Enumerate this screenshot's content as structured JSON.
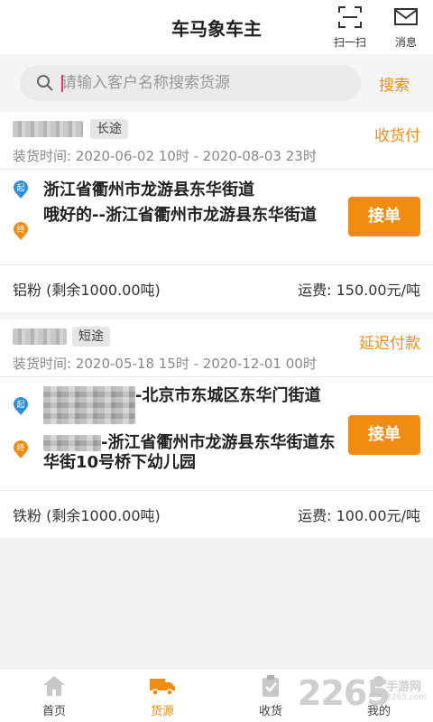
{
  "header": {
    "title": "车马象车主",
    "scan_label": "扫一扫",
    "message_label": "消息"
  },
  "search": {
    "placeholder": "请输入客户名称搜索货源",
    "button_label": "搜索"
  },
  "orders": [
    {
      "route_type": "长途",
      "payment": "收货付",
      "load_time": "装货时间: 2020-06-02 10时 - 2020-08-03 23时",
      "start_icon_label": "起",
      "end_icon_label": "终",
      "start_address": "浙江省衢州市龙游县东华街道",
      "end_address": "哦好的--浙江省衢州市龙游县东华街道",
      "accept_label": "接单",
      "goods": "铝粉 (剩余1000.00吨)",
      "freight": "运费: 150.00元/吨"
    },
    {
      "route_type": "短途",
      "payment": "延迟付款",
      "load_time": "装货时间: 2020-05-18 15时 - 2020-12-01 00时",
      "start_icon_label": "起",
      "end_icon_label": "终",
      "start_address": "-北京市东城区东华门街道",
      "end_address": "-浙江省衢州市龙游县东华街道东华街10号桥下幼儿园",
      "accept_label": "接单",
      "goods": "铁粉 (剩余1000.00吨)",
      "freight": "运费: 100.00元/吨"
    }
  ],
  "tabs": [
    {
      "label": "首页",
      "icon": "home-icon"
    },
    {
      "label": "货源",
      "icon": "truck-icon"
    },
    {
      "label": "收货",
      "icon": "clipboard-check-icon"
    },
    {
      "label": "我的",
      "icon": "user-icon"
    }
  ],
  "watermark": {
    "number": "2265",
    "text": "手游网",
    "url": "2265.com"
  },
  "colors": {
    "accent": "#f18c10",
    "start_pin": "#2a8ee0",
    "end_pin": "#f18c10"
  }
}
